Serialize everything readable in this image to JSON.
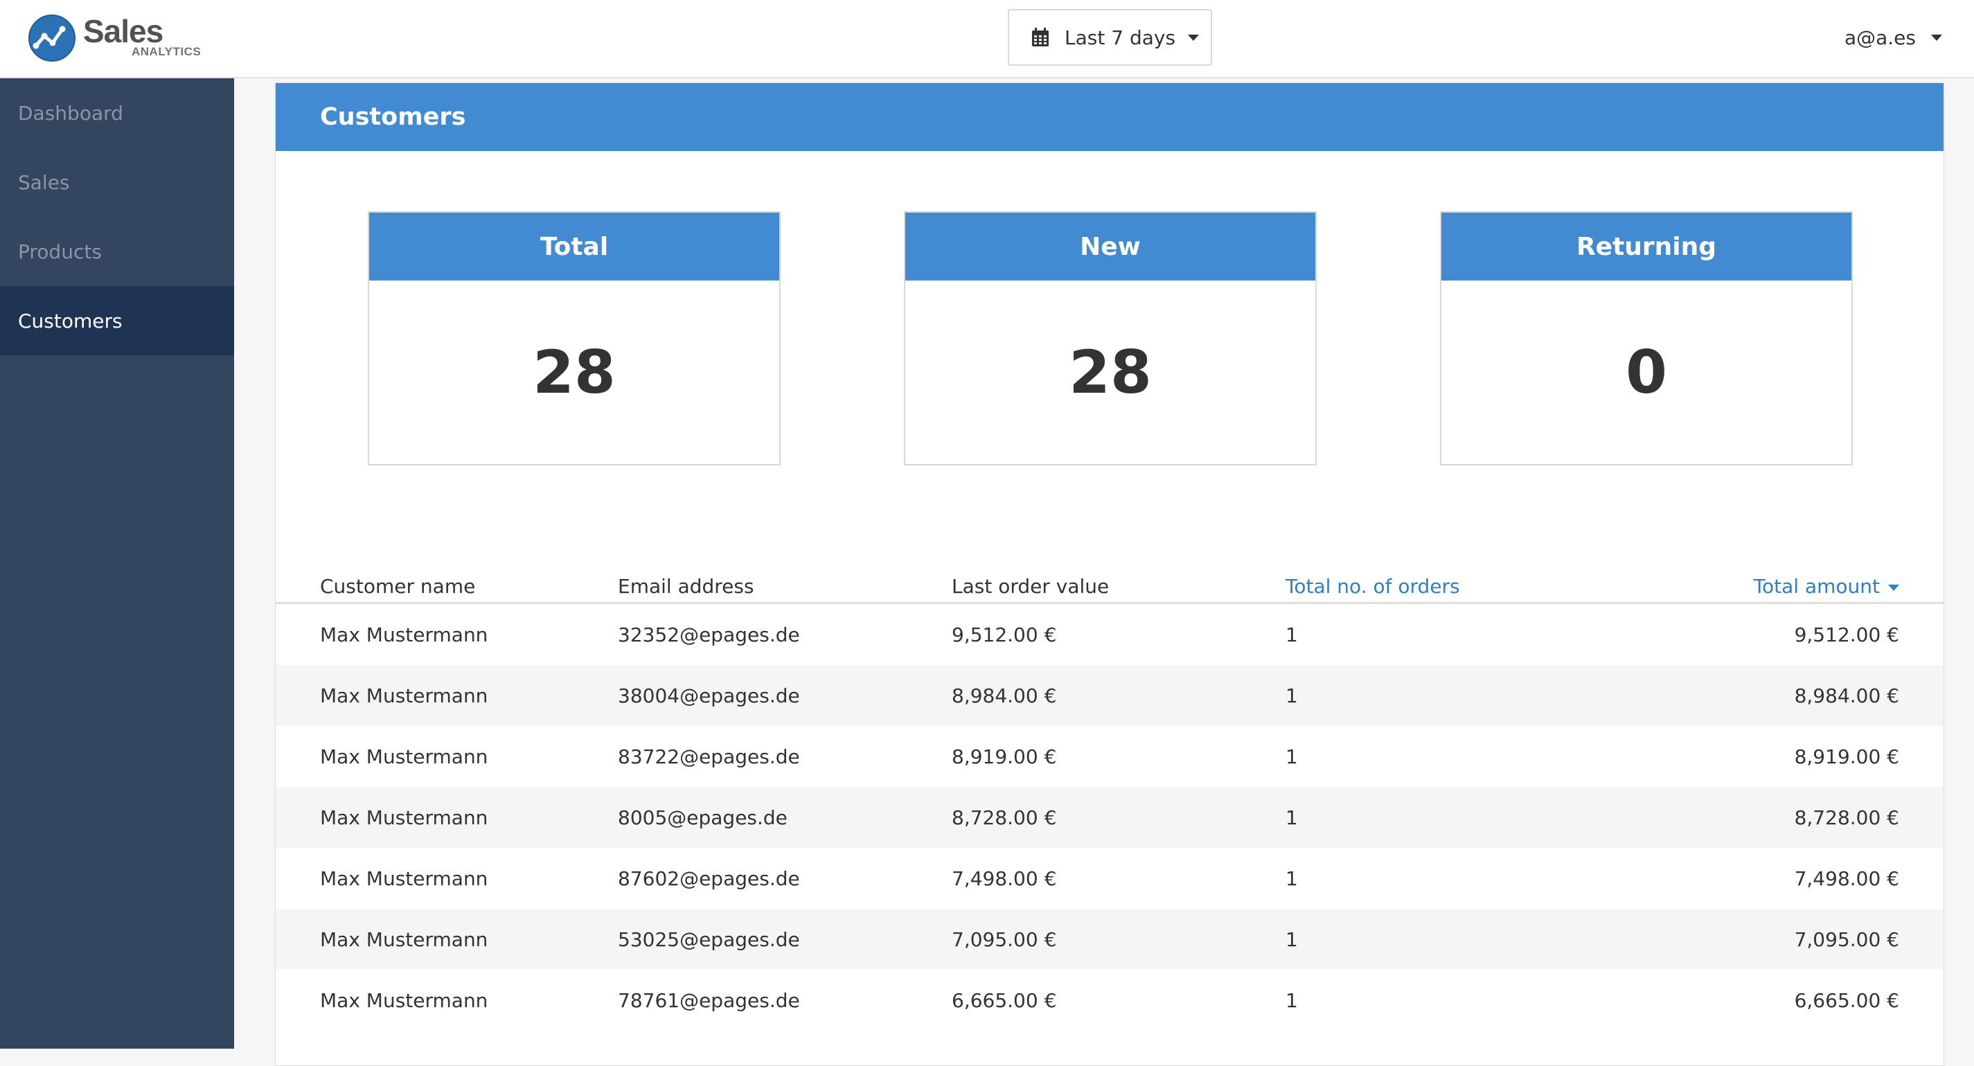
{
  "app": {
    "logo_title": "Sales",
    "logo_subtitle": "ANALYTICS"
  },
  "header": {
    "date_range_label": "Last 7 days",
    "user_label": "a@a.es"
  },
  "sidebar": {
    "items": [
      {
        "label": "Dashboard"
      },
      {
        "label": "Sales"
      },
      {
        "label": "Products"
      },
      {
        "label": "Customers"
      }
    ],
    "active": "Customers"
  },
  "panel": {
    "title": "Customers"
  },
  "kpis": [
    {
      "label": "Total",
      "value": "28"
    },
    {
      "label": "New",
      "value": "28"
    },
    {
      "label": "Returning",
      "value": "0"
    }
  ],
  "table": {
    "columns": [
      "Customer name",
      "Email address",
      "Last order value",
      "Total no. of orders",
      "Total amount"
    ],
    "sort_column": "Total amount",
    "sort_direction": "desc",
    "rows": [
      {
        "name": "Max Mustermann",
        "email": "32352@epages.de",
        "last_order": "9,512.00 €",
        "orders": "1",
        "total": "9,512.00 €"
      },
      {
        "name": "Max Mustermann",
        "email": "38004@epages.de",
        "last_order": "8,984.00 €",
        "orders": "1",
        "total": "8,984.00 €"
      },
      {
        "name": "Max Mustermann",
        "email": "83722@epages.de",
        "last_order": "8,919.00 €",
        "orders": "1",
        "total": "8,919.00 €"
      },
      {
        "name": "Max Mustermann",
        "email": "8005@epages.de",
        "last_order": "8,728.00 €",
        "orders": "1",
        "total": "8,728.00 €"
      },
      {
        "name": "Max Mustermann",
        "email": "87602@epages.de",
        "last_order": "7,498.00 €",
        "orders": "1",
        "total": "7,498.00 €"
      },
      {
        "name": "Max Mustermann",
        "email": "53025@epages.de",
        "last_order": "7,095.00 €",
        "orders": "1",
        "total": "7,095.00 €"
      },
      {
        "name": "Max Mustermann",
        "email": "78761@epages.de",
        "last_order": "6,665.00 €",
        "orders": "1",
        "total": "6,665.00 €"
      }
    ]
  },
  "colors": {
    "accent": "#428bd3",
    "sidebar_bg": "#33455f",
    "sidebar_active": "#1f3352",
    "link": "#2f7fc6"
  }
}
